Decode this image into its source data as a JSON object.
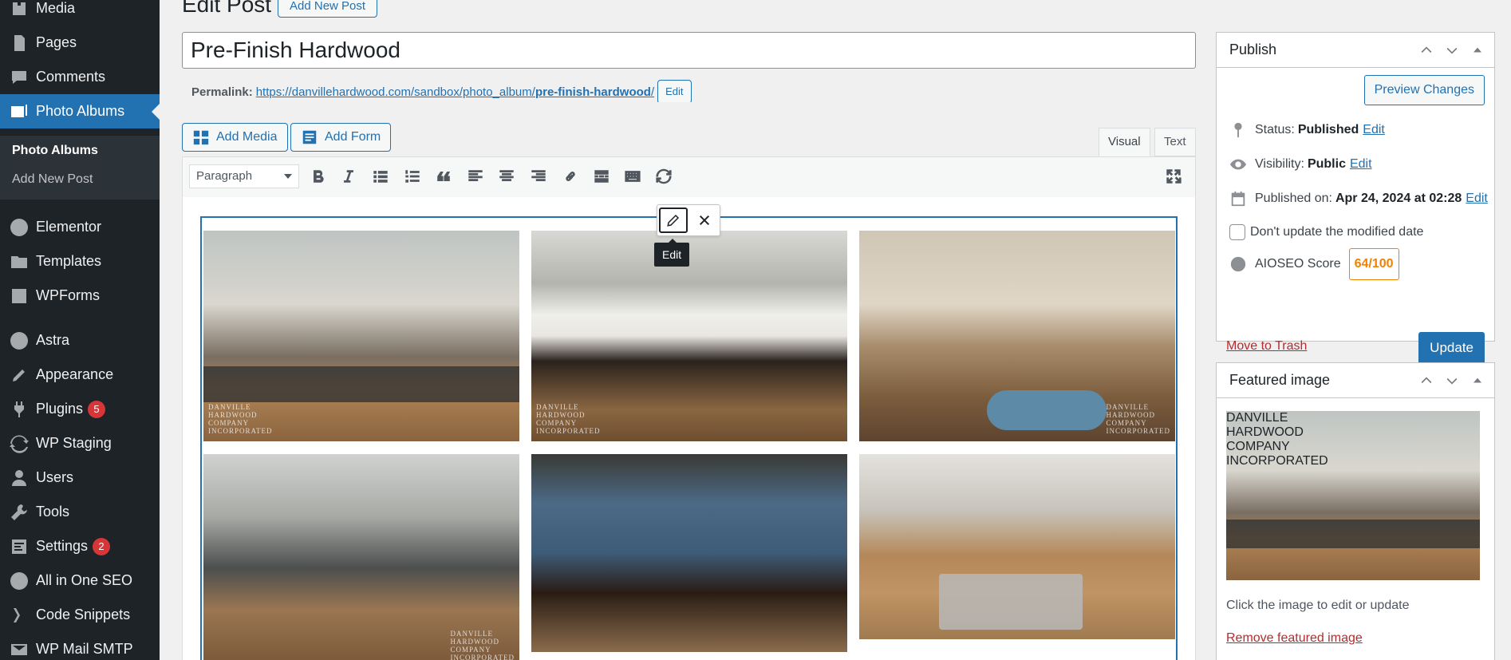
{
  "sidebar": {
    "items": [
      {
        "label": "Media",
        "icon": "media-icon"
      },
      {
        "label": "Pages",
        "icon": "pages-icon"
      },
      {
        "label": "Comments",
        "icon": "comments-icon"
      },
      {
        "label": "Photo Albums",
        "icon": "photo-albums-icon"
      },
      {
        "label": "Elementor",
        "icon": "elementor-icon"
      },
      {
        "label": "Templates",
        "icon": "templates-icon"
      },
      {
        "label": "WPForms",
        "icon": "wpforms-icon"
      },
      {
        "label": "Astra",
        "icon": "astra-icon"
      },
      {
        "label": "Appearance",
        "icon": "appearance-icon"
      },
      {
        "label": "Plugins",
        "icon": "plugins-icon",
        "badge": "5"
      },
      {
        "label": "WP Staging",
        "icon": "wp-staging-icon"
      },
      {
        "label": "Users",
        "icon": "users-icon"
      },
      {
        "label": "Tools",
        "icon": "tools-icon"
      },
      {
        "label": "Settings",
        "icon": "settings-icon",
        "badge": "2"
      },
      {
        "label": "All in One SEO",
        "icon": "aioseo-icon"
      },
      {
        "label": "Code Snippets",
        "icon": "code-snippets-icon"
      },
      {
        "label": "WP Mail SMTP",
        "icon": "wp-mail-smtp-icon"
      }
    ],
    "submenu": {
      "active": "Photo Albums",
      "add_new": "Add New Post"
    }
  },
  "header": {
    "title": "Edit Post",
    "add_new": "Add New Post"
  },
  "post": {
    "title": "Pre-Finish Hardwood",
    "permalink_label": "Permalink:",
    "permalink_base": "https://danvillehardwood.com/sandbox/photo_album/",
    "permalink_slug": "pre-finish-hardwood",
    "permalink_trail": "/",
    "permalink_edit": "Edit"
  },
  "editor": {
    "add_media": "Add Media",
    "add_form": "Add Form",
    "tab_visual": "Visual",
    "tab_text": "Text",
    "format": "Paragraph",
    "tooltip": "Edit"
  },
  "watermark": [
    "DANVILLE",
    "HARDWOOD",
    "COMPANY",
    "INCORPORATED"
  ],
  "publish": {
    "title": "Publish",
    "preview": "Preview Changes",
    "status_label": "Status:",
    "status_value": "Published",
    "visibility_label": "Visibility:",
    "visibility_value": "Public",
    "published_label": "Published on:",
    "published_value": "Apr 24, 2024 at 02:28",
    "edit": "Edit",
    "dont_update": "Don't update the modified date",
    "aioseo_label": "AIOSEO Score",
    "aioseo_score": "64/100",
    "trash": "Move to Trash",
    "update": "Update"
  },
  "featured": {
    "title": "Featured image",
    "caption": "Click the image to edit or update",
    "remove": "Remove featured image"
  }
}
